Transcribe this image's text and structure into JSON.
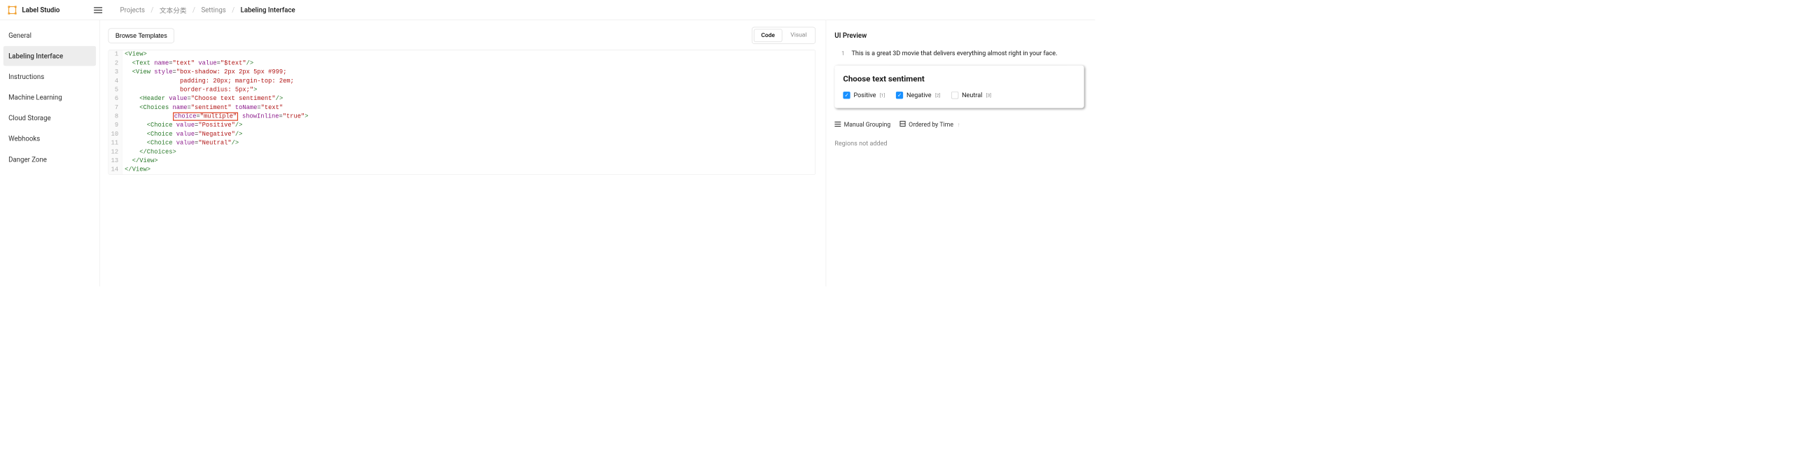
{
  "header": {
    "app_name": "Label Studio",
    "breadcrumbs": [
      "Projects",
      "文本分类",
      "Settings",
      "Labeling Interface"
    ]
  },
  "sidebar": {
    "items": [
      {
        "label": "General",
        "active": false
      },
      {
        "label": "Labeling Interface",
        "active": true
      },
      {
        "label": "Instructions",
        "active": false
      },
      {
        "label": "Machine Learning",
        "active": false
      },
      {
        "label": "Cloud Storage",
        "active": false
      },
      {
        "label": "Webhooks",
        "active": false
      },
      {
        "label": "Danger Zone",
        "active": false
      }
    ]
  },
  "center": {
    "browse_btn": "Browse Templates",
    "toggle": {
      "code": "Code",
      "visual": "Visual",
      "active": "code"
    },
    "code_lines": [
      [
        {
          "t": "<",
          "c": "tag-bracket"
        },
        {
          "t": "View",
          "c": "tag-name"
        },
        {
          "t": ">",
          "c": "tag-bracket"
        }
      ],
      [
        {
          "t": "  ",
          "c": ""
        },
        {
          "t": "<",
          "c": "tag-bracket"
        },
        {
          "t": "Text",
          "c": "tag-name"
        },
        {
          "t": " ",
          "c": ""
        },
        {
          "t": "name",
          "c": "attr-name"
        },
        {
          "t": "=",
          "c": "attr-eq"
        },
        {
          "t": "\"text\"",
          "c": "attr-value"
        },
        {
          "t": " ",
          "c": ""
        },
        {
          "t": "value",
          "c": "attr-name"
        },
        {
          "t": "=",
          "c": "attr-eq"
        },
        {
          "t": "\"$text\"",
          "c": "attr-value"
        },
        {
          "t": "/>",
          "c": "tag-bracket"
        }
      ],
      [
        {
          "t": "  ",
          "c": ""
        },
        {
          "t": "<",
          "c": "tag-bracket"
        },
        {
          "t": "View",
          "c": "tag-name"
        },
        {
          "t": " ",
          "c": ""
        },
        {
          "t": "style",
          "c": "attr-name"
        },
        {
          "t": "=",
          "c": "attr-eq"
        },
        {
          "t": "\"box-shadow: 2px 2px 5px #999;",
          "c": "attr-value"
        }
      ],
      [
        {
          "t": "               padding: 20px; margin-top: 2em;",
          "c": "attr-value"
        }
      ],
      [
        {
          "t": "               border-radius: 5px;\"",
          "c": "attr-value"
        },
        {
          "t": ">",
          "c": "tag-bracket"
        }
      ],
      [
        {
          "t": "    ",
          "c": ""
        },
        {
          "t": "<",
          "c": "tag-bracket"
        },
        {
          "t": "Header",
          "c": "tag-name"
        },
        {
          "t": " ",
          "c": ""
        },
        {
          "t": "value",
          "c": "attr-name"
        },
        {
          "t": "=",
          "c": "attr-eq"
        },
        {
          "t": "\"Choose text sentiment\"",
          "c": "attr-value"
        },
        {
          "t": "/>",
          "c": "tag-bracket"
        }
      ],
      [
        {
          "t": "    ",
          "c": ""
        },
        {
          "t": "<",
          "c": "tag-bracket"
        },
        {
          "t": "Choices",
          "c": "tag-name"
        },
        {
          "t": " ",
          "c": ""
        },
        {
          "t": "name",
          "c": "attr-name"
        },
        {
          "t": "=",
          "c": "attr-eq"
        },
        {
          "t": "\"sentiment\"",
          "c": "attr-value"
        },
        {
          "t": " ",
          "c": ""
        },
        {
          "t": "toName",
          "c": "attr-name"
        },
        {
          "t": "=",
          "c": "attr-eq"
        },
        {
          "t": "\"text\"",
          "c": "attr-value"
        }
      ],
      [
        {
          "t": "             ",
          "c": ""
        },
        {
          "t": "[[HL_OPEN]]",
          "c": ""
        },
        {
          "t": "choice",
          "c": "attr-name"
        },
        {
          "t": "=",
          "c": "attr-eq"
        },
        {
          "t": "\"multiple\"",
          "c": "attr-value"
        },
        {
          "t": "[[HL_CLOSE]]",
          "c": ""
        },
        {
          "t": " ",
          "c": ""
        },
        {
          "t": "showInline",
          "c": "attr-name"
        },
        {
          "t": "=",
          "c": "attr-eq"
        },
        {
          "t": "\"true\"",
          "c": "attr-value"
        },
        {
          "t": ">",
          "c": "tag-bracket"
        }
      ],
      [
        {
          "t": "      ",
          "c": ""
        },
        {
          "t": "<",
          "c": "tag-bracket"
        },
        {
          "t": "Choice",
          "c": "tag-name"
        },
        {
          "t": " ",
          "c": ""
        },
        {
          "t": "value",
          "c": "attr-name"
        },
        {
          "t": "=",
          "c": "attr-eq"
        },
        {
          "t": "\"Positive\"",
          "c": "attr-value"
        },
        {
          "t": "/>",
          "c": "tag-bracket"
        }
      ],
      [
        {
          "t": "      ",
          "c": ""
        },
        {
          "t": "<",
          "c": "tag-bracket"
        },
        {
          "t": "Choice",
          "c": "tag-name"
        },
        {
          "t": " ",
          "c": ""
        },
        {
          "t": "value",
          "c": "attr-name"
        },
        {
          "t": "=",
          "c": "attr-eq"
        },
        {
          "t": "\"Negative\"",
          "c": "attr-value"
        },
        {
          "t": "/>",
          "c": "tag-bracket"
        }
      ],
      [
        {
          "t": "      ",
          "c": ""
        },
        {
          "t": "<",
          "c": "tag-bracket"
        },
        {
          "t": "Choice",
          "c": "tag-name"
        },
        {
          "t": " ",
          "c": ""
        },
        {
          "t": "value",
          "c": "attr-name"
        },
        {
          "t": "=",
          "c": "attr-eq"
        },
        {
          "t": "\"Neutral\"",
          "c": "attr-value"
        },
        {
          "t": "/>",
          "c": "tag-bracket"
        }
      ],
      [
        {
          "t": "    ",
          "c": ""
        },
        {
          "t": "</",
          "c": "tag-bracket"
        },
        {
          "t": "Choices",
          "c": "tag-name"
        },
        {
          "t": ">",
          "c": "tag-bracket"
        }
      ],
      [
        {
          "t": "  ",
          "c": ""
        },
        {
          "t": "</",
          "c": "tag-bracket"
        },
        {
          "t": "View",
          "c": "tag-name"
        },
        {
          "t": ">",
          "c": "tag-bracket"
        }
      ],
      [
        {
          "t": "</",
          "c": "tag-bracket"
        },
        {
          "t": "View",
          "c": "tag-name"
        },
        {
          "t": ">",
          "c": "tag-bracket"
        }
      ]
    ]
  },
  "preview": {
    "title": "UI Preview",
    "sample_index": "1",
    "sample_text": "This is a great 3D movie that delivers everything almost right in your face.",
    "card_header": "Choose text sentiment",
    "choices": [
      {
        "label": "Positive",
        "hot": "[1]",
        "checked": true
      },
      {
        "label": "Negative",
        "hot": "[2]",
        "checked": true
      },
      {
        "label": "Neutral",
        "hot": "[3]",
        "checked": false
      }
    ],
    "grouping": {
      "manual": "Manual Grouping",
      "ordered": "Ordered by Time"
    },
    "regions_empty": "Regions not added"
  }
}
